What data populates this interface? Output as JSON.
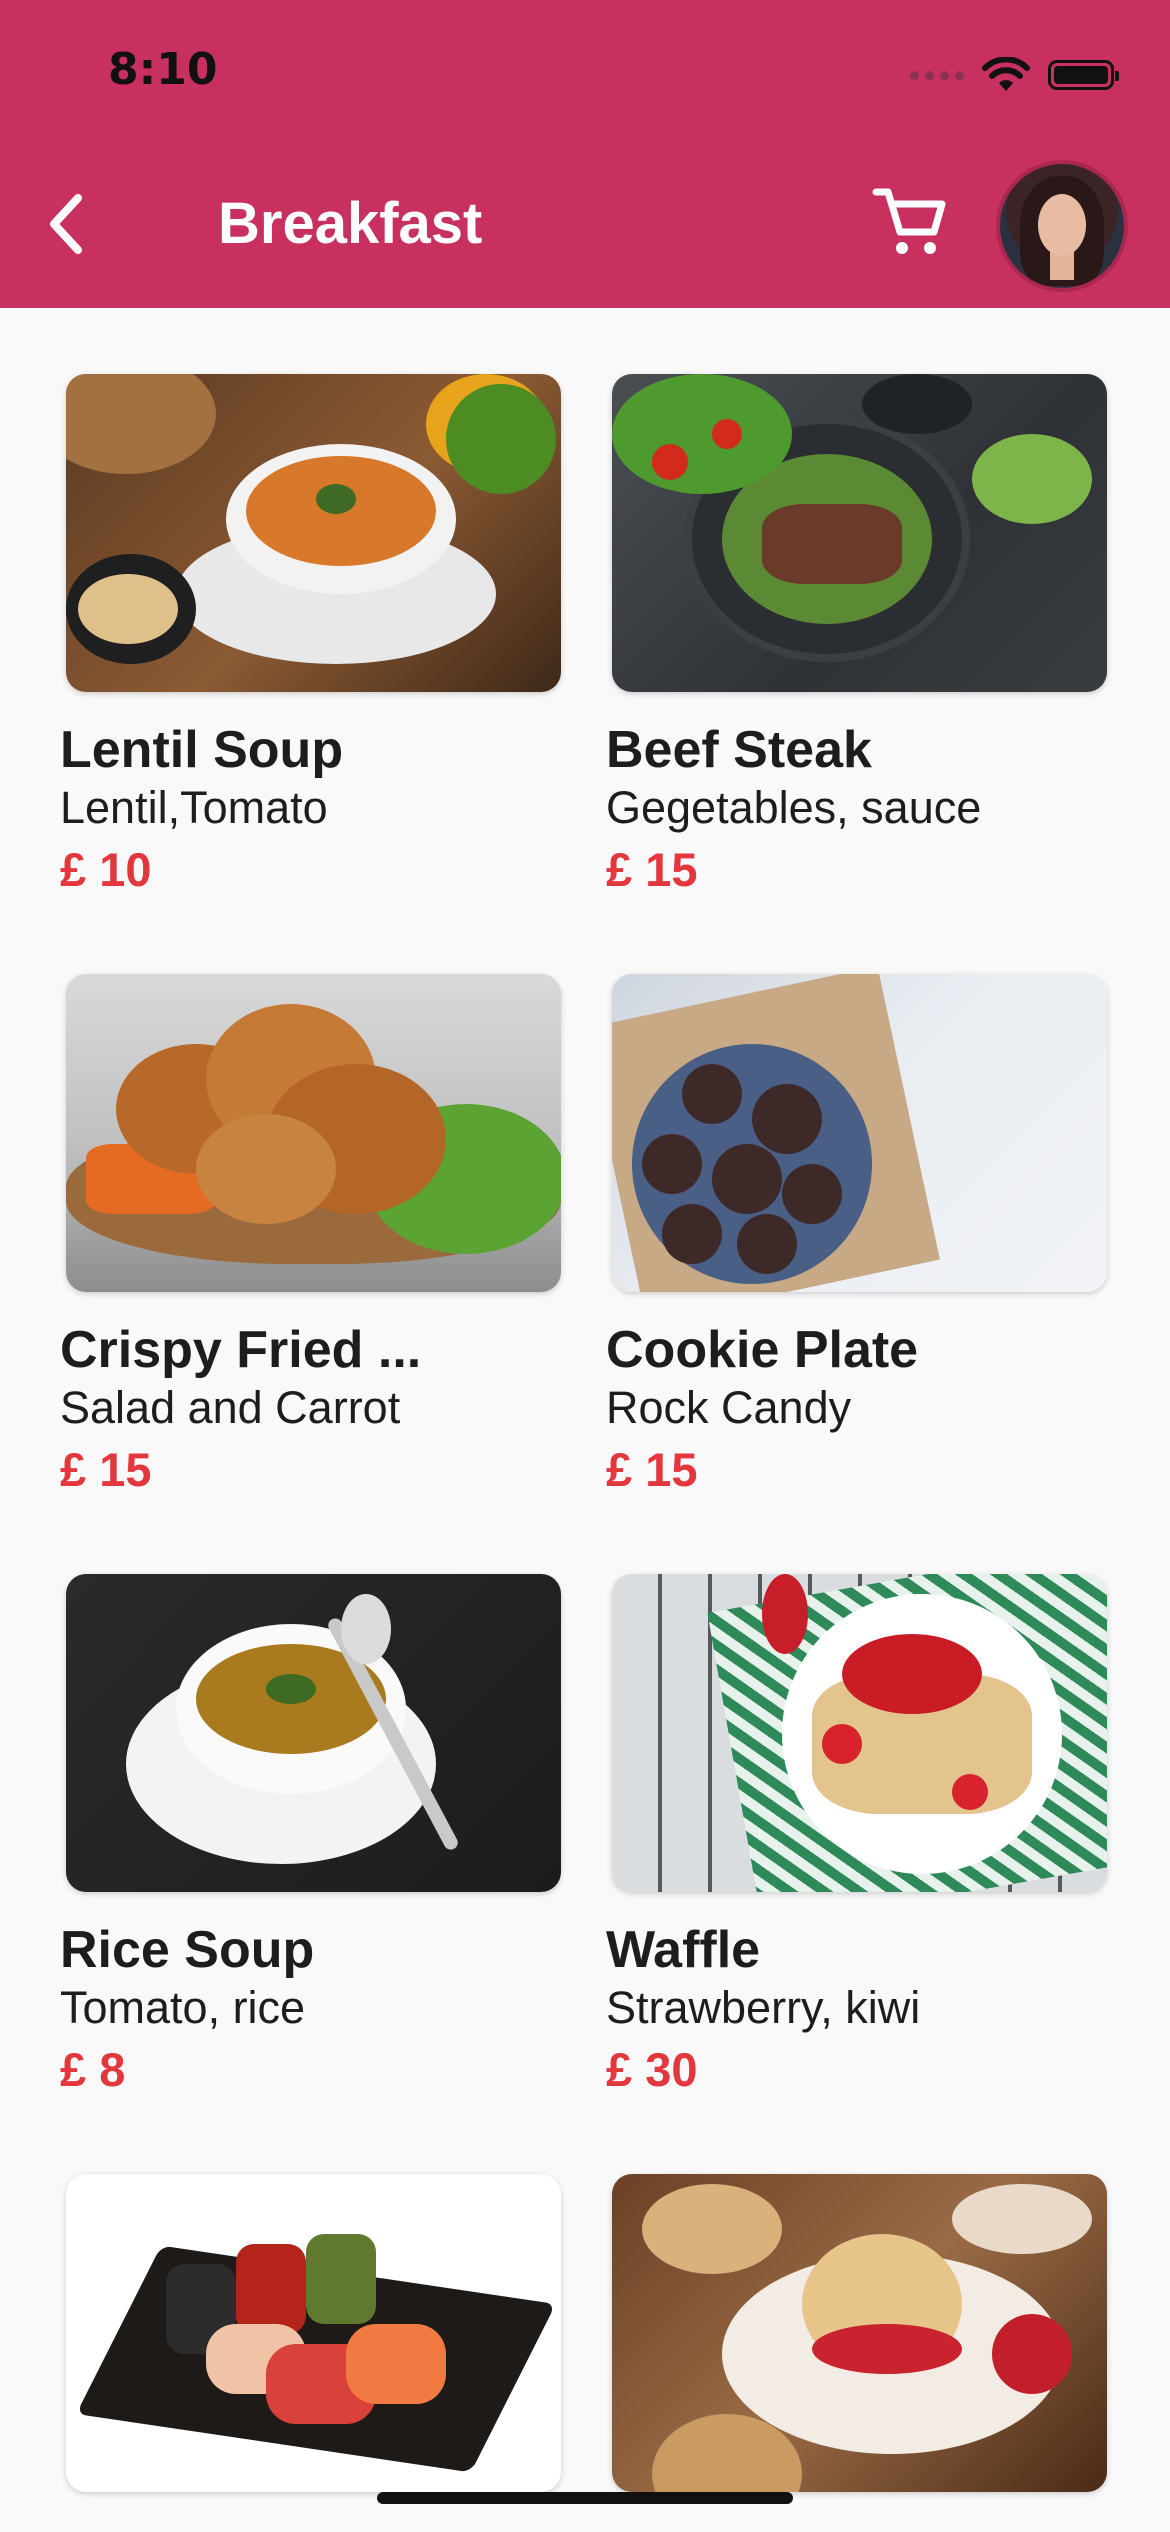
{
  "status_bar": {
    "time": "8:10"
  },
  "header": {
    "title": "Breakfast",
    "back_icon": "chevron-left-icon",
    "cart_icon": "cart-icon",
    "accent_color": "#c8305f"
  },
  "items": [
    {
      "title": "Lentil Soup",
      "subtitle": "Lentil,Tomato",
      "price": "£ 10"
    },
    {
      "title": "Beef Steak",
      "subtitle": "Gegetables, sauce",
      "price": "£ 15"
    },
    {
      "title": "Crispy Fried ...",
      "subtitle": "Salad and Carrot",
      "price": "£ 15"
    },
    {
      "title": "Cookie Plate",
      "subtitle": "Rock Candy",
      "price": "£ 15"
    },
    {
      "title": "Rice Soup",
      "subtitle": "Tomato, rice",
      "price": "£ 8"
    },
    {
      "title": "Waffle",
      "subtitle": "Strawberry, kiwi",
      "price": "£ 30"
    },
    {
      "title": "",
      "subtitle": "",
      "price": ""
    },
    {
      "title": "",
      "subtitle": "",
      "price": ""
    }
  ],
  "colors": {
    "price": "#e2373d",
    "text": "#1d1d1d",
    "background": "#f9f9f9"
  }
}
